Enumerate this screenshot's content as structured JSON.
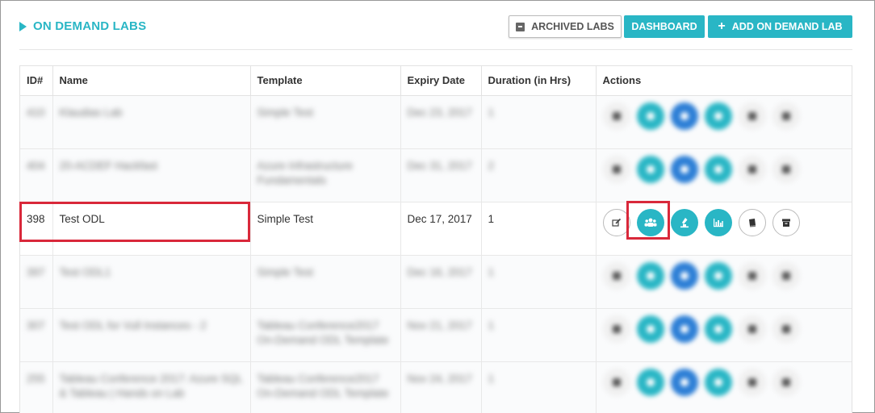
{
  "header": {
    "title": "ON DEMAND LABS",
    "archived_label": "ARCHIVED LABS",
    "dashboard_label": "DASHBOARD",
    "add_label": "ADD ON DEMAND LAB"
  },
  "table": {
    "columns": [
      "ID#",
      "Name",
      "Template",
      "Expiry Date",
      "Duration (in Hrs)",
      "Actions"
    ],
    "rows": [
      {
        "id": "410",
        "name": "Klaudias Lab",
        "template": "Simple Test",
        "expiry": "Dec 23, 2017",
        "duration": "1",
        "blurred": true
      },
      {
        "id": "404",
        "name": "20-ACDEF Hackfast",
        "template": "Azure Infrastructure Fundamentals",
        "expiry": "Dec 31, 2017",
        "duration": "2",
        "blurred": true
      },
      {
        "id": "398",
        "name": "Test ODL",
        "template": "Simple Test",
        "expiry": "Dec 17, 2017",
        "duration": "1",
        "blurred": false
      },
      {
        "id": "397",
        "name": "Test ODL1",
        "template": "Simple Test",
        "expiry": "Dec 16, 2017",
        "duration": "1",
        "blurred": true
      },
      {
        "id": "307",
        "name": "Test ODL for Vull Instances - 2",
        "template": "Tableau Conference2017 On-Demand ODL Template",
        "expiry": "Nov 21, 2017",
        "duration": "1",
        "blurred": true
      },
      {
        "id": "255",
        "name": "Tableau Conference 2017: Azure SQL & Tableau | Hands on Lab",
        "template": "Tableau Conference2017 On-Demand ODL Template",
        "expiry": "Nov 24, 2017",
        "duration": "1",
        "blurred": true
      }
    ]
  },
  "icons": {
    "edit": "edit-icon",
    "users": "users-icon",
    "flask": "flask-icon",
    "chart": "bar-chart-icon",
    "book": "book-icon",
    "archive": "archive-icon"
  },
  "colors": {
    "accent": "#29b6c5",
    "highlight": "#d9283a"
  }
}
